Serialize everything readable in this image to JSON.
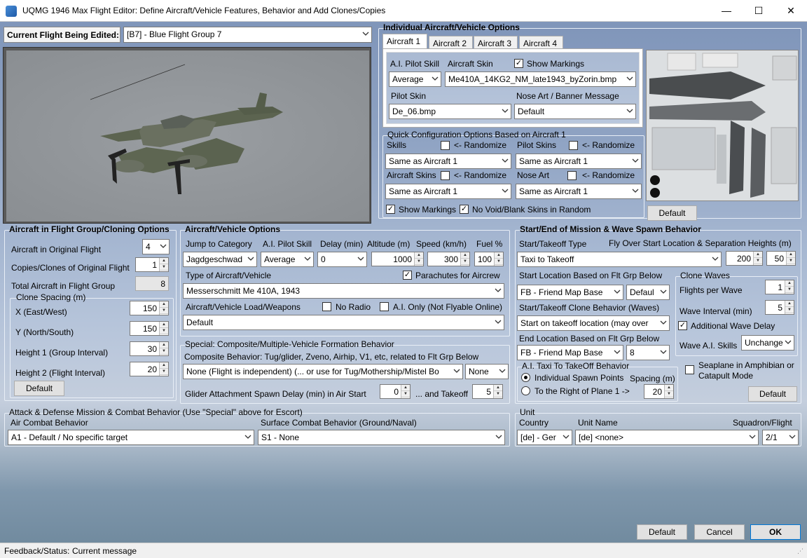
{
  "window": {
    "title": "UQMG 1946 Max Flight Editor:  Define Aircraft/Vehicle Features, Behavior and Add Clones/Copies",
    "min": "—",
    "max": "☐",
    "close": "✕"
  },
  "current_flight": {
    "label": "Current Flight Being Edited:",
    "value": "[B7] - Blue Flight Group  7"
  },
  "individual": {
    "title": "Individual Aircraft/Vehicle Options",
    "tabs": [
      "Aircraft 1",
      "Aircraft 2",
      "Aircraft 3",
      "Aircraft 4"
    ],
    "pilot_skill_label": "A.I. Pilot Skill",
    "pilot_skill": "Average",
    "skin_label": "Aircraft Skin",
    "skin": "Me410A_14KG2_NM_late1943_byZorin.bmp",
    "show_markings": "Show Markings",
    "pilot_skin_label": "Pilot Skin",
    "pilot_skin": "De_06.bmp",
    "nose_art_label": "Nose Art / Banner Message",
    "nose_art": "Default",
    "skin_default_btn": "Default"
  },
  "quick": {
    "title": "Quick Configuration Options Based on Aircraft 1",
    "skills_label": "Skills",
    "randomize": "<- Randomize",
    "skills": "Same as Aircraft 1",
    "pilot_skins_label": "Pilot Skins",
    "pilot_skins": "Same as Aircraft 1",
    "aircraft_skins_label": "Aircraft Skins",
    "aircraft_skins": "Same as Aircraft 1",
    "nose_art_label": "Nose Art",
    "nose_art": "Same as Aircraft 1",
    "show_markings": "Show Markings",
    "no_void": "No Void/Blank Skins in Random"
  },
  "flight_group": {
    "title": "Aircraft in Flight Group/Cloning Options",
    "orig_label": "Aircraft in Original Flight",
    "orig": "4",
    "copies_label": "Copies/Clones of Original Flight",
    "copies": "1",
    "total_label": "Total Aircraft in Flight Group",
    "total": "8",
    "spacing_title": "Clone Spacing (m)",
    "x_label": "X (East/West)",
    "x": "150",
    "y_label": "Y (North/South)",
    "y": "150",
    "h1_label": "Height 1 (Group Interval)",
    "h1": "30",
    "h2_label": "Height 2 (Flight Interval)",
    "h2": "20",
    "default_btn": "Default"
  },
  "vehicle": {
    "title": "Aircraft/Vehicle Options",
    "jump_label": "Jump to Category",
    "jump": "Jagdgeschwad",
    "skill_label": "A.I. Pilot Skill",
    "skill": "Average",
    "delay_label": "Delay (min)",
    "delay": "0",
    "alt_label": "Altitude (m)",
    "alt": "1000",
    "speed_label": "Speed (km/h)",
    "speed": "300",
    "fuel_label": "Fuel %",
    "fuel": "100",
    "type_label": "Type of Aircraft/Vehicle",
    "parachutes": "Parachutes for Aircrew",
    "type": "Messerschmitt Me 410A, 1943",
    "load_label": "Aircraft/Vehicle Load/Weapons",
    "no_radio": "No Radio",
    "ai_only": "A.I. Only (Not Flyable Online)",
    "load": "Default"
  },
  "special": {
    "title": "Special: Composite/Multiple-Vehicle Formation Behavior",
    "comp_label": "Composite Behavior: Tug/glider, Zveno, Airhip, V1, etc, related to Flt Grp Below",
    "comp": "None (Flight is independent) (... or use for Tug/Mothership/Mistel Bo",
    "comp2": "None",
    "glider_label": "Glider Attachment Spawn Delay (min) in Air Start",
    "glider_air": "0",
    "takeoff_label": "... and Takeoff",
    "glider_takeoff": "5"
  },
  "start": {
    "title": "Start/End of Mission & Wave Spawn Behavior",
    "type_label": "Start/Takeoff Type",
    "flyover_label": "Fly Over Start Location & Separation Heights (m)",
    "type": "Taxi to Takeoff",
    "h1": "200",
    "h2": "50",
    "loc_label": "Start Location Based on Flt Grp Below",
    "loc": "FB - Friend Map Base",
    "loc2": "Defaul",
    "clone_label": "Start/Takeoff Clone Behavior (Waves)",
    "clone": "Start on takeoff location (may over",
    "end_label": "End Location Based on Flt Grp Below",
    "end": "FB - Friend Map Base",
    "end2": "8",
    "taxi_title": "A.I. Taxi To TakeOff Behavior",
    "spawn_points": "Individual Spawn Points",
    "spacing_label": "Spacing (m)",
    "right_of": "To the Right of Plane 1 ->",
    "spacing": "20",
    "waves_title": "Clone Waves",
    "fpw_label": "Flights per Wave",
    "fpw": "1",
    "interval_label": "Wave Interval (min)",
    "interval": "5",
    "add_delay": "Additional Wave Delay",
    "skills_label": "Wave A.I. Skills",
    "skills": "Unchange",
    "seaplane": "Seaplane in Amphibian or Catapult Mode",
    "default_btn": "Default"
  },
  "attack": {
    "title": "Attack & Defense Mission & Combat Behavior (Use \"Special\" above for Escort)",
    "air_label": "Air Combat Behavior",
    "air": "A1 - Default / No specific target",
    "surface_label": "Surface Combat Behavior (Ground/Naval)",
    "surface": "S1 - None"
  },
  "unit": {
    "title": "Unit",
    "country_label": "Country",
    "country": "[de] - Ger",
    "name_label": "Unit Name",
    "name": "[de] <none>",
    "squad_label": "Squadron/Flight",
    "squad": "2/1"
  },
  "footer": {
    "default_btn": "Default",
    "cancel_btn": "Cancel",
    "ok_btn": "OK"
  },
  "status": {
    "label": "Feedback/Status:",
    "message": "Current message"
  }
}
